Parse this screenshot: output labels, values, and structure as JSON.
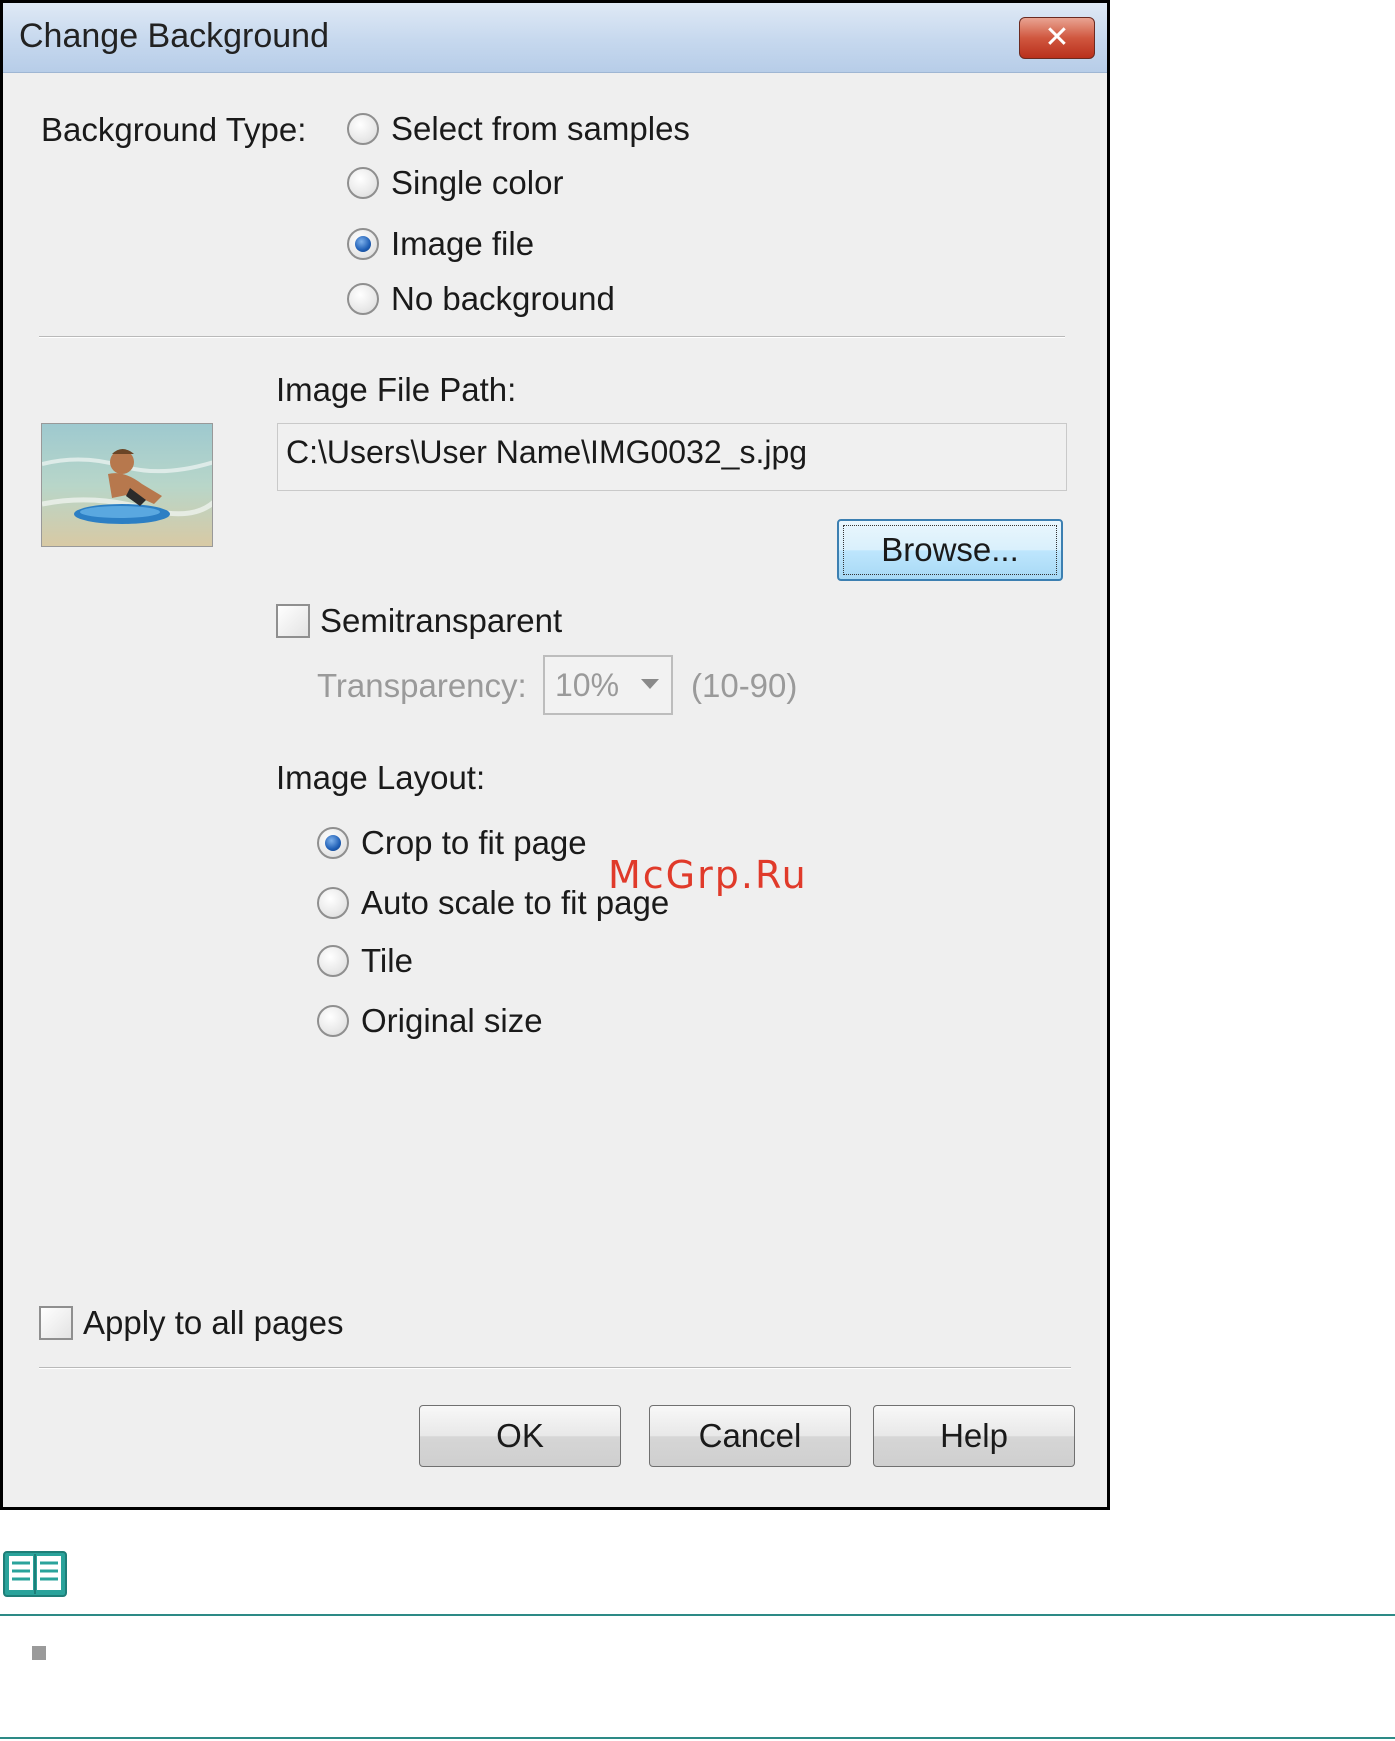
{
  "dialog": {
    "title": "Change Background",
    "close_icon": "close-icon"
  },
  "background_type": {
    "label": "Background Type:",
    "options": [
      {
        "label": "Select from samples",
        "checked": false
      },
      {
        "label": "Single color",
        "checked": false
      },
      {
        "label": "Image file",
        "checked": true
      },
      {
        "label": "No background",
        "checked": false
      }
    ]
  },
  "image_file": {
    "path_label": "Image File Path:",
    "path_value": "C:\\Users\\User Name\\IMG0032_s.jpg",
    "browse_label": "Browse..."
  },
  "semitransparent": {
    "label": "Semitransparent",
    "checked": false,
    "transparency_label": "Transparency:",
    "transparency_value": "10%",
    "range_text": "(10-90)"
  },
  "image_layout": {
    "label": "Image Layout:",
    "options": [
      {
        "label": "Crop to fit page",
        "checked": true
      },
      {
        "label": "Auto scale to fit page",
        "checked": false
      },
      {
        "label": "Tile",
        "checked": false
      },
      {
        "label": "Original size",
        "checked": false
      }
    ]
  },
  "apply_all": {
    "label": "Apply to all pages",
    "checked": false
  },
  "buttons": {
    "ok": "OK",
    "cancel": "Cancel",
    "help": "Help"
  },
  "watermark": "McGrp.Ru",
  "note": {
    "icon": "book-icon"
  }
}
